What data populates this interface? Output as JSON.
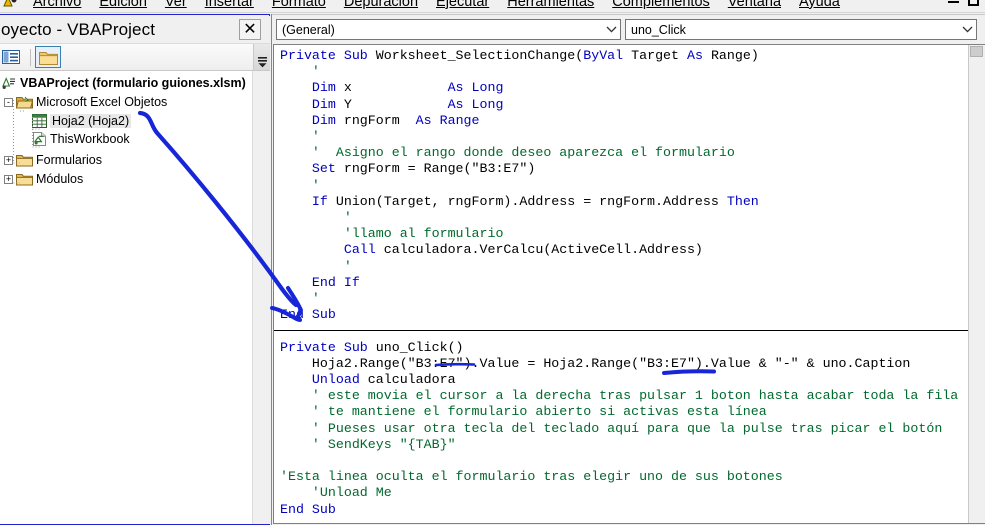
{
  "menubar": {
    "items": [
      {
        "label": "Archivo",
        "accel": "A"
      },
      {
        "label": "Edición",
        "accel": "E"
      },
      {
        "label": "Ver",
        "accel": "V"
      },
      {
        "label": "Insertar",
        "accel": "I"
      },
      {
        "label": "Formato",
        "accel": "F"
      },
      {
        "label": "Depuración",
        "accel": "D"
      },
      {
        "label": "Ejecutar",
        "accel": "u"
      },
      {
        "label": "Herramientas",
        "accel": "H"
      },
      {
        "label": "Complementos",
        "accel": "C"
      },
      {
        "label": "Ventana",
        "accel": "n"
      },
      {
        "label": "Ayuda",
        "accel": "y"
      }
    ],
    "minimize_label": "minimize",
    "maximize_label": "maximize"
  },
  "project_explorer": {
    "title": "oyecto - VBAProject",
    "close_label": "✕",
    "toolbar": {
      "view_code_icon": "view-code-icon",
      "toggle_folders_icon": "toggle-folders-icon",
      "overflow_icon": "toolbar-overflow-icon"
    },
    "tree": {
      "root": {
        "label": "VBAProject (formulario guiones.xlsm)",
        "icon": "vbaproject-icon"
      },
      "nodes": [
        {
          "label": "Microsoft Excel Objetos",
          "icon": "folder-open-icon",
          "expander": "-",
          "depth": 1,
          "selected": false
        },
        {
          "label": "Hoja2 (Hoja2)",
          "icon": "worksheet-icon",
          "expander": "",
          "depth": 2,
          "selected": true
        },
        {
          "label": "ThisWorkbook",
          "icon": "workbook-icon",
          "expander": "",
          "depth": 2,
          "selected": false
        },
        {
          "label": "Formularios",
          "icon": "folder-icon",
          "expander": "+",
          "depth": 1,
          "selected": false
        },
        {
          "label": "Módulos",
          "icon": "folder-icon",
          "expander": "+",
          "depth": 1,
          "selected": false
        }
      ]
    }
  },
  "code_window": {
    "object_combo": {
      "value": "(General)",
      "arrow_icon": "chevron-down-icon"
    },
    "procedure_combo": {
      "value": "uno_Click",
      "arrow_icon": "chevron-down-icon"
    },
    "lines": [
      {
        "t": "code",
        "s": [
          [
            "kw",
            "Private Sub "
          ],
          [
            "pl",
            "Worksheet_SelectionChange("
          ],
          [
            "kw",
            "ByVal "
          ],
          [
            "pl",
            "Target "
          ],
          [
            "kw",
            "As "
          ],
          [
            "pl",
            "Range)"
          ]
        ]
      },
      {
        "t": "code",
        "s": [
          [
            "cm",
            "    '"
          ]
        ]
      },
      {
        "t": "code",
        "s": [
          [
            "kw",
            "    Dim "
          ],
          [
            "pl",
            "x            "
          ],
          [
            "kw",
            "As Long"
          ]
        ]
      },
      {
        "t": "code",
        "s": [
          [
            "kw",
            "    Dim "
          ],
          [
            "pl",
            "Y            "
          ],
          [
            "kw",
            "As Long"
          ]
        ]
      },
      {
        "t": "code",
        "s": [
          [
            "kw",
            "    Dim "
          ],
          [
            "pl",
            "rngForm  "
          ],
          [
            "kw",
            "As Range"
          ]
        ]
      },
      {
        "t": "code",
        "s": [
          [
            "cm",
            "    '"
          ]
        ]
      },
      {
        "t": "code",
        "s": [
          [
            "cm",
            "    '  Asigno el rango donde deseo aparezca el formulario"
          ]
        ]
      },
      {
        "t": "code",
        "s": [
          [
            "kw",
            "    Set "
          ],
          [
            "pl",
            "rngForm = Range(\"B3:E7\")"
          ]
        ]
      },
      {
        "t": "code",
        "s": [
          [
            "cm",
            "    '"
          ]
        ]
      },
      {
        "t": "code",
        "s": [
          [
            "kw",
            "    If "
          ],
          [
            "pl",
            "Union(Target, rngForm).Address = rngForm.Address "
          ],
          [
            "kw",
            "Then"
          ]
        ]
      },
      {
        "t": "code",
        "s": [
          [
            "cm",
            "        '"
          ]
        ]
      },
      {
        "t": "code",
        "s": [
          [
            "cm",
            "        'llamo al formulario"
          ]
        ]
      },
      {
        "t": "code",
        "s": [
          [
            "kw",
            "        Call "
          ],
          [
            "pl",
            "calculadora.VerCalcu(ActiveCell.Address)"
          ]
        ]
      },
      {
        "t": "code",
        "s": [
          [
            "cm",
            "        '"
          ]
        ]
      },
      {
        "t": "code",
        "s": [
          [
            "kw",
            "    End If"
          ]
        ]
      },
      {
        "t": "code",
        "s": [
          [
            "cm",
            "    '"
          ]
        ]
      },
      {
        "t": "code",
        "s": [
          [
            "kw",
            "End Sub"
          ]
        ]
      },
      {
        "t": "sep",
        "s": []
      },
      {
        "t": "code",
        "s": [
          [
            "kw",
            "Private Sub "
          ],
          [
            "pl",
            "uno_Click()"
          ]
        ]
      },
      {
        "t": "code",
        "s": [
          [
            "pl",
            "    Hoja2.Range(\"B3:E7\").Value = Hoja2.Range(\"B3:E7\").Value & \"-\" & uno.Caption"
          ]
        ]
      },
      {
        "t": "code",
        "s": [
          [
            "kw",
            "    Unload "
          ],
          [
            "pl",
            "calculadora"
          ]
        ]
      },
      {
        "t": "code",
        "s": [
          [
            "cm",
            "    ' este movia el cursor a la derecha tras pulsar 1 boton hasta acabar toda la fila"
          ]
        ]
      },
      {
        "t": "code",
        "s": [
          [
            "cm",
            "    ' te mantiene el formulario abierto si activas esta línea"
          ]
        ]
      },
      {
        "t": "code",
        "s": [
          [
            "cm",
            "    ' Pueses usar otra tecla del teclado aquí para que la pulse tras picar el botón"
          ]
        ]
      },
      {
        "t": "code",
        "s": [
          [
            "cm",
            "    ' SendKeys \"{TAB}\""
          ]
        ]
      },
      {
        "t": "code",
        "s": [
          [
            "pl",
            ""
          ]
        ]
      },
      {
        "t": "code",
        "s": [
          [
            "cm",
            "'Esta linea oculta el formulario tras elegir uno de sus botones"
          ]
        ]
      },
      {
        "t": "code",
        "s": [
          [
            "cm",
            "    'Unload Me"
          ]
        ]
      },
      {
        "t": "code",
        "s": [
          [
            "kw",
            "End Sub"
          ]
        ]
      }
    ]
  },
  "annotations": {
    "ink_color": "#1726d8",
    "arrow_name": "blue-arrow-hoja2-to-end-sub",
    "underline_1_name": "blue-underline-range-b3e7-left",
    "underline_2_name": "blue-underline-range-b3e7-right"
  },
  "colors": {
    "keyword": "#0000c0",
    "comment": "#006a2e",
    "ink": "#1726d8",
    "panel_border": "#2222cc",
    "selection": "#e8e8e8"
  }
}
